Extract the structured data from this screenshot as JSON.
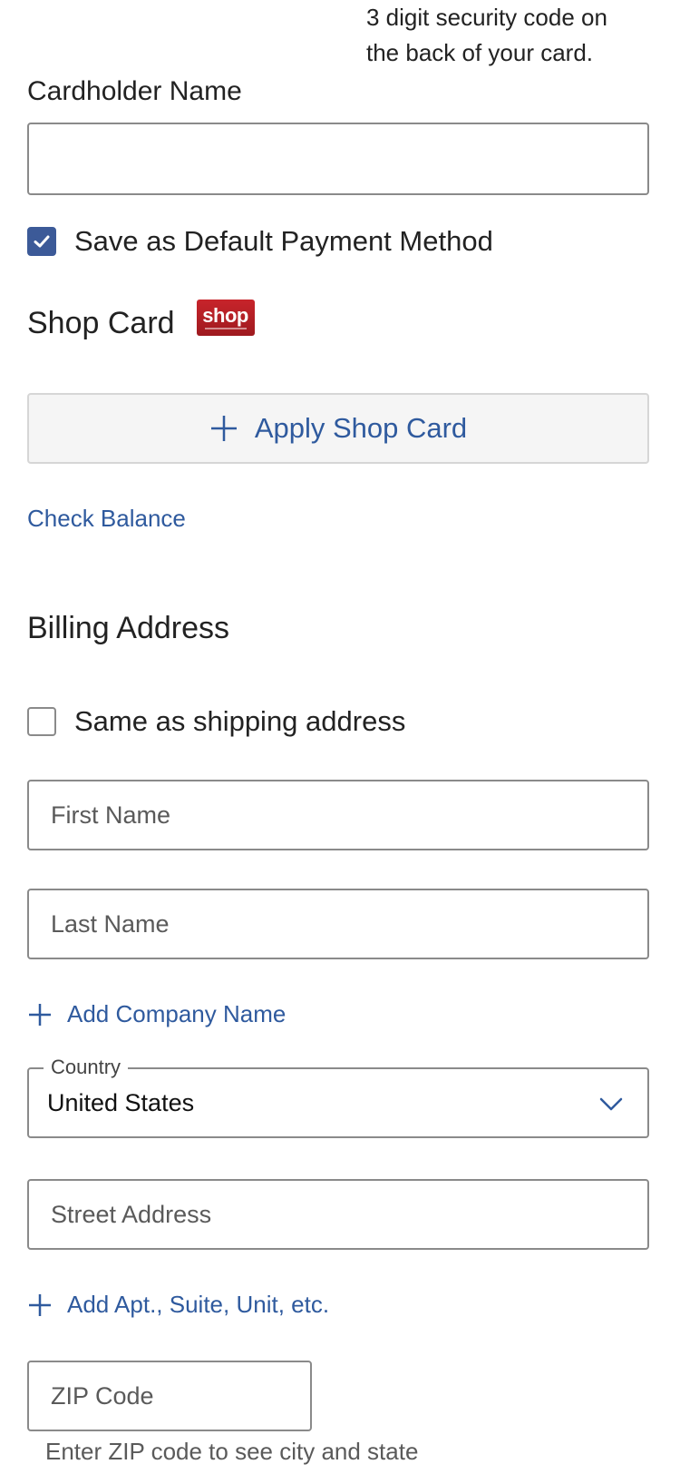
{
  "cvv_hint": {
    "line1": "3 digit security code on",
    "line2": "the back of your card."
  },
  "cardholder": {
    "label": "Cardholder Name",
    "value": ""
  },
  "save_default": {
    "label": "Save as Default Payment Method",
    "checked": true
  },
  "shop_card": {
    "title": "Shop Card",
    "logo_text": "shop",
    "apply_button": "Apply Shop Card",
    "check_balance": "Check Balance"
  },
  "billing": {
    "heading": "Billing Address",
    "same_as_shipping": {
      "label": "Same as shipping address",
      "checked": false
    },
    "first_name_placeholder": "First Name",
    "last_name_placeholder": "Last Name",
    "add_company": "Add Company Name",
    "country": {
      "legend": "Country",
      "value": "United States"
    },
    "street_placeholder": "Street Address",
    "add_apt": "Add Apt., Suite, Unit, etc.",
    "zip_placeholder": "ZIP Code",
    "zip_helper": "Enter ZIP code to see city and state"
  },
  "colors": {
    "link": "#2f5a9e",
    "checkbox_checked": "#3c5a98",
    "shop_logo": "#c8242b"
  },
  "icons": {
    "checkmark": "check-icon",
    "plus": "plus-icon",
    "chevron": "chevron-down-icon",
    "shop_logo": "shop-card-logo"
  }
}
